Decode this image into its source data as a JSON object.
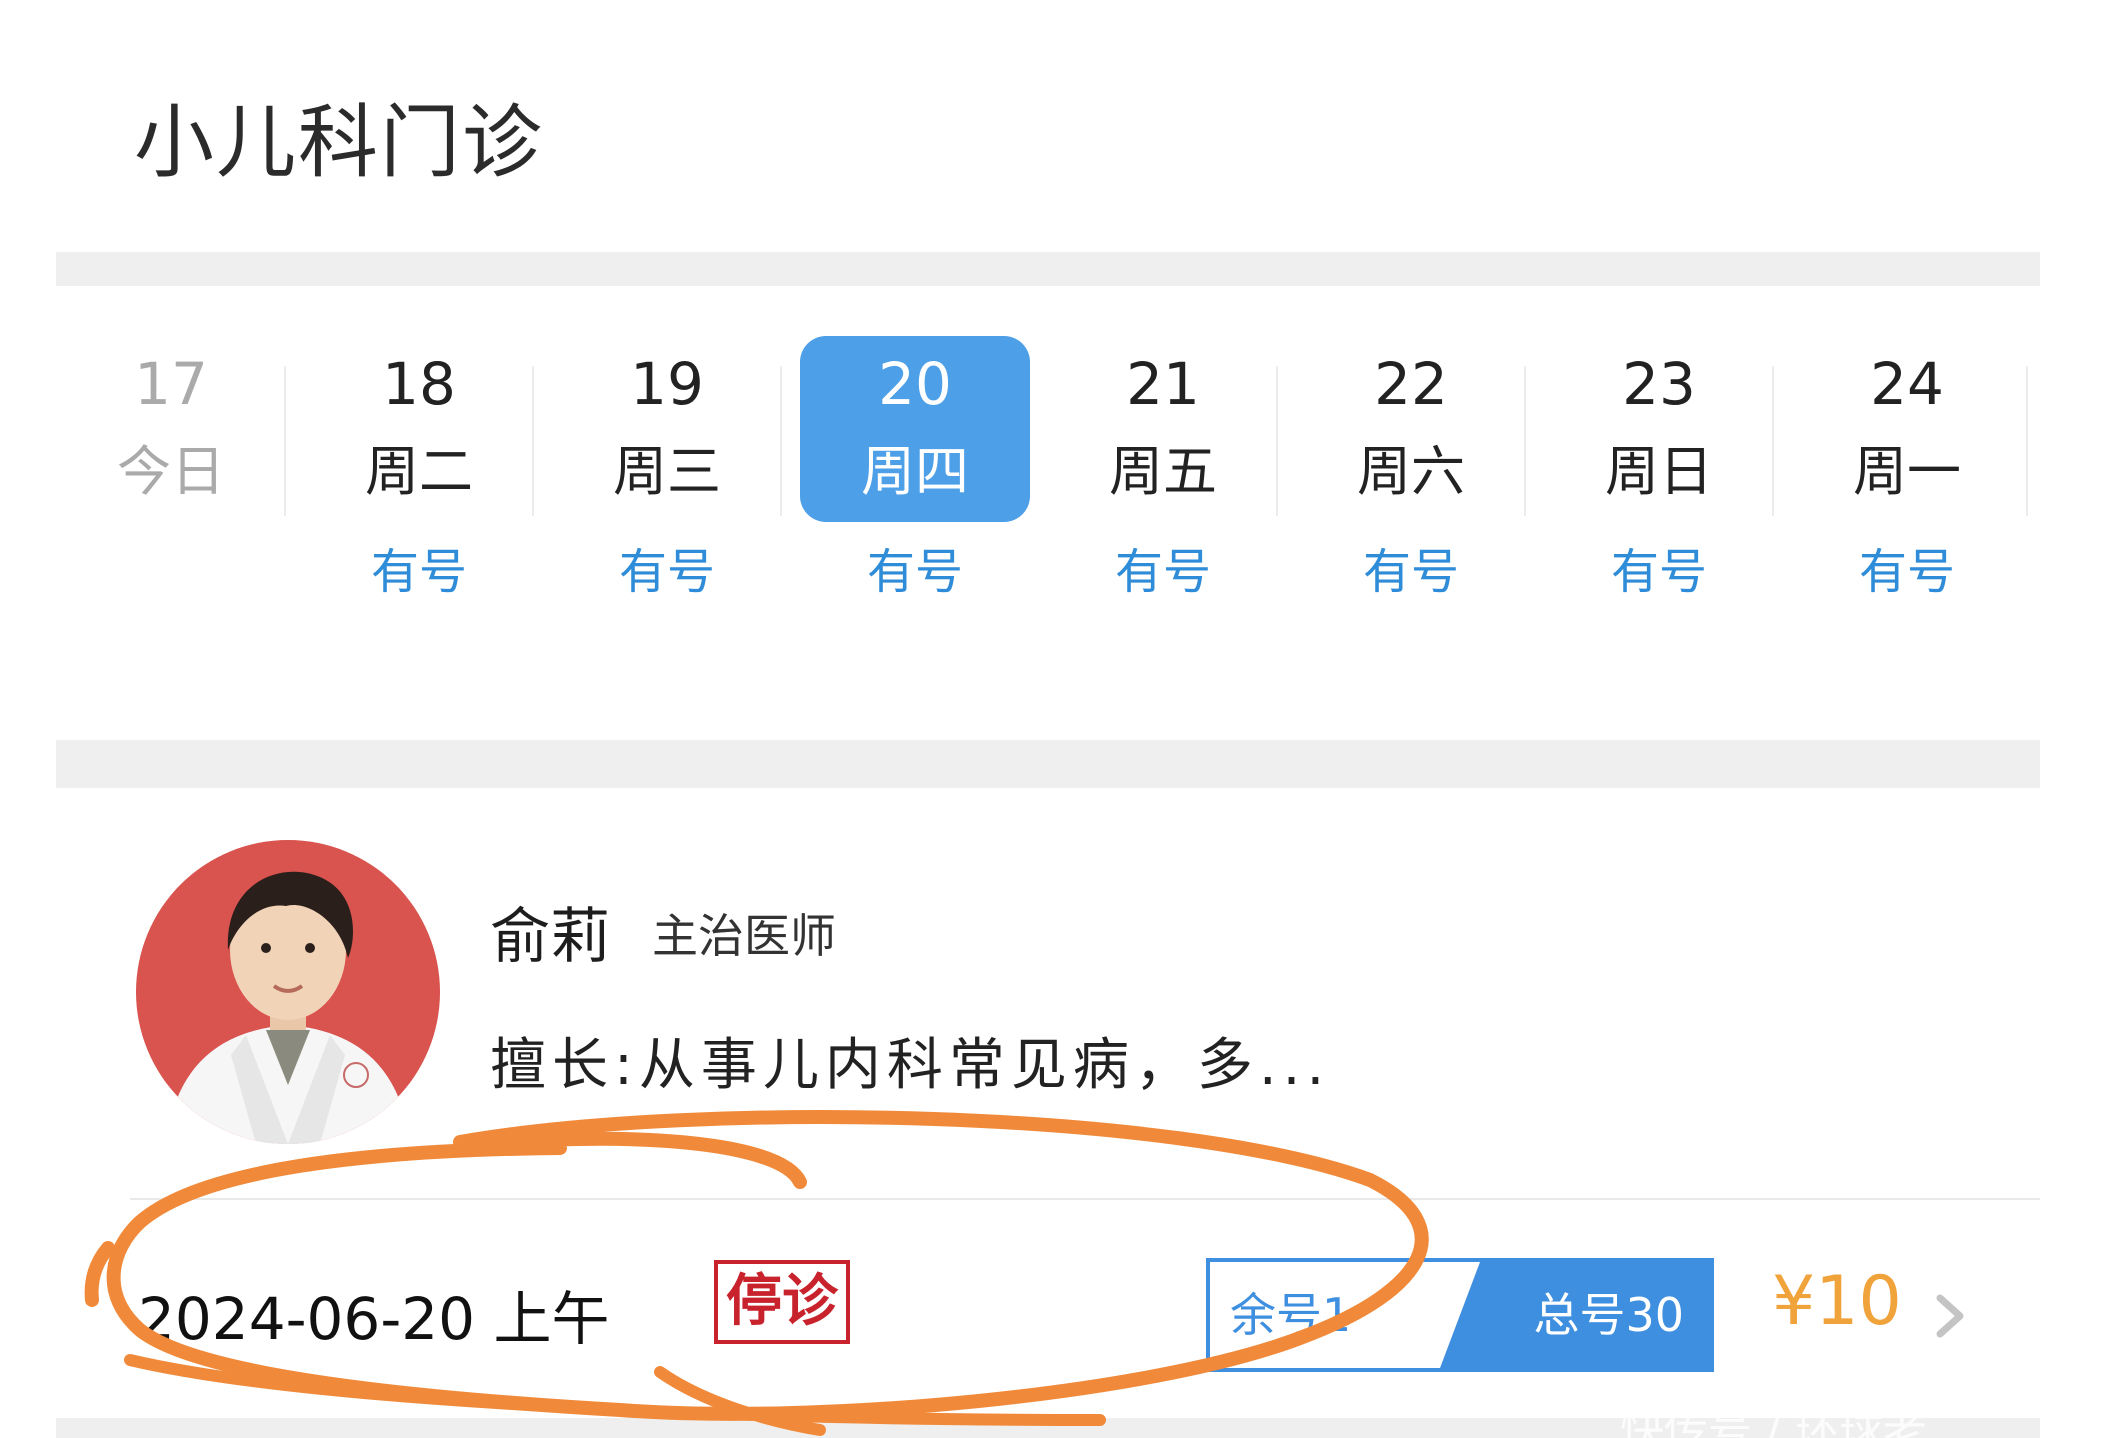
{
  "page": {
    "title": "小儿科门诊"
  },
  "dates": [
    {
      "num": "17",
      "weekday": "今日",
      "availability": "",
      "state": "today"
    },
    {
      "num": "18",
      "weekday": "周二",
      "availability": "有号",
      "state": "normal"
    },
    {
      "num": "19",
      "weekday": "周三",
      "availability": "有号",
      "state": "normal"
    },
    {
      "num": "20",
      "weekday": "周四",
      "availability": "有号",
      "state": "selected"
    },
    {
      "num": "21",
      "weekday": "周五",
      "availability": "有号",
      "state": "normal"
    },
    {
      "num": "22",
      "weekday": "周六",
      "availability": "有号",
      "state": "normal"
    },
    {
      "num": "23",
      "weekday": "周日",
      "availability": "有号",
      "state": "normal"
    },
    {
      "num": "24",
      "weekday": "周一",
      "availability": "有号",
      "state": "normal"
    }
  ],
  "doctor": {
    "name": "俞莉",
    "title": "主治医师",
    "specialty": "擅长:从事儿内科常见病，多..."
  },
  "schedule": {
    "date_label": "2024-06-20 上午",
    "status_badge": "停诊",
    "remaining": "余号1",
    "total": "总号30",
    "price": "¥10"
  },
  "watermark": "快传号 / 环球老",
  "colors": {
    "accent_blue": "#4d9fe8",
    "availability_blue": "#2f8cd8",
    "stop_red": "#c8232c",
    "price_orange": "#f0a33a",
    "annotation_orange": "#f08a3a"
  },
  "icons": {
    "chevron": "chevron-right-icon"
  }
}
